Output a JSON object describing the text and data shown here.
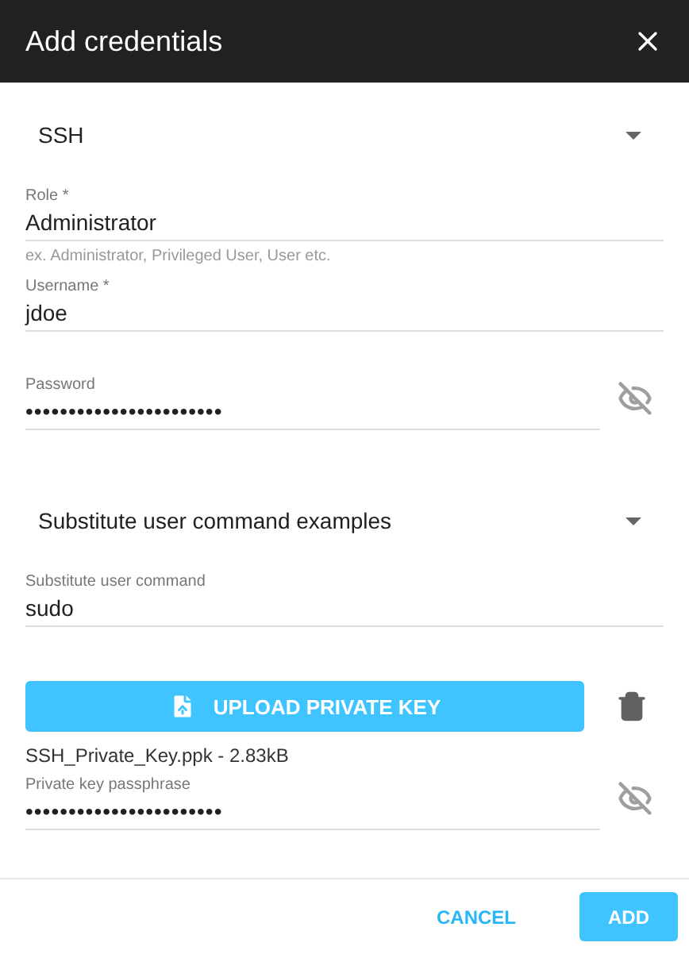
{
  "dialog": {
    "title": "Add credentials"
  },
  "fields": [
    {
      "kind": "select",
      "value": "SSH"
    },
    {
      "kind": "text",
      "label": "Role *",
      "value": "Administrator",
      "hint": "ex. Administrator, Privileged User, User etc."
    },
    {
      "kind": "text",
      "label": "Username *",
      "value": "jdoe"
    },
    {
      "kind": "password",
      "label": "Password",
      "value": "•••••••••••••••••••••••"
    },
    {
      "kind": "select",
      "value": "Substitute user command examples"
    },
    {
      "kind": "text",
      "label": "Substitute user command",
      "value": "sudo"
    },
    {
      "kind": "upload",
      "label": "UPLOAD PRIVATE KEY"
    },
    {
      "kind": "file",
      "value": "SSH_Private_Key.ppk - 2.83kB"
    },
    {
      "kind": "password",
      "label": "Private key passphrase",
      "value": "•••••••••••••••••••••••"
    }
  ],
  "actions": [
    {
      "label": "CANCEL",
      "kind": "text"
    },
    {
      "label": "ADD",
      "kind": "primary"
    }
  ]
}
